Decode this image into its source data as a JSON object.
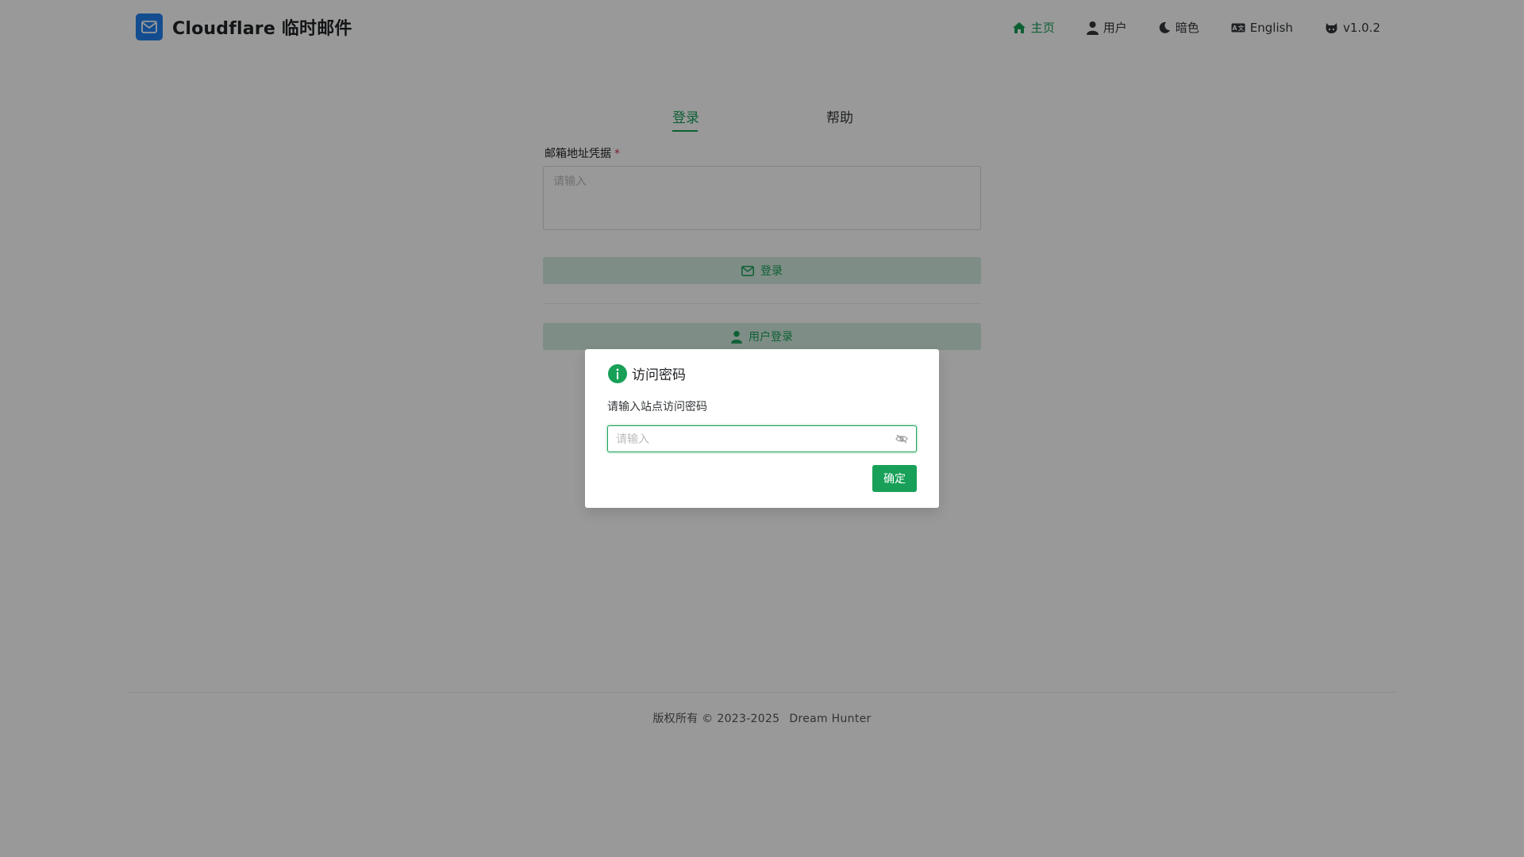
{
  "app": {
    "title": "Cloudflare 临时邮件",
    "logo_icon": "mail-icon"
  },
  "nav": {
    "items": [
      {
        "label": "主页",
        "icon": "home-icon",
        "active": true
      },
      {
        "label": "用户",
        "icon": "user-icon",
        "active": false
      },
      {
        "label": "暗色",
        "icon": "moon-icon",
        "active": false
      },
      {
        "label": "English",
        "icon": "language-icon",
        "active": false
      },
      {
        "label": "v1.0.2",
        "icon": "github-icon",
        "active": false
      }
    ]
  },
  "login_card": {
    "tabs": [
      {
        "label": "登录",
        "active": true
      },
      {
        "label": "帮助",
        "active": false
      }
    ],
    "credential_label": "邮箱地址凭据",
    "required_mark": "*",
    "credential_placeholder": "请输入",
    "login_button": "登录",
    "user_login_button": "用户登录"
  },
  "footer": {
    "copyright": "版权所有 © 2023-2025",
    "author": "Dream Hunter"
  },
  "modal": {
    "title": "访问密码",
    "description": "请输入站点访问密码",
    "password_placeholder": "请输入",
    "confirm_button": "确定"
  },
  "colors": {
    "primary": "#18a058",
    "brand_logo": "#2080f0",
    "overlay": "rgba(0,0,0,0.4)",
    "required": "#d03050"
  }
}
